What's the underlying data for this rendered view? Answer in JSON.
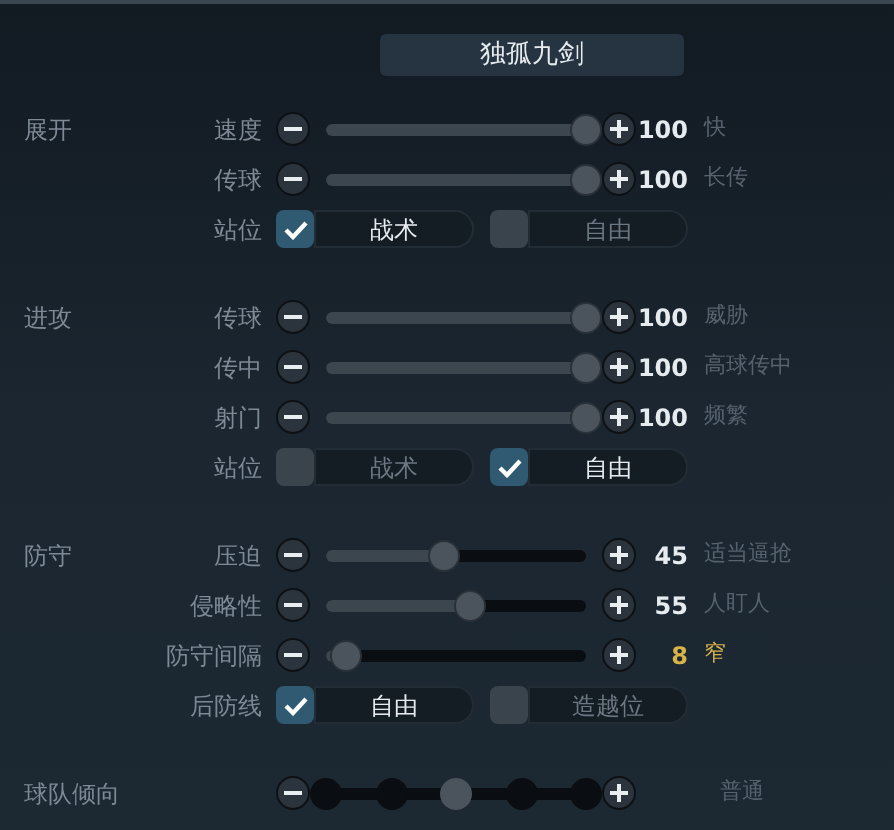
{
  "title": "独孤九剑",
  "sections": [
    {
      "label": "展开",
      "rows": [
        {
          "kind": "slider",
          "label": "速度",
          "level": 1,
          "value": "100",
          "description": "快",
          "highlighted": false
        },
        {
          "kind": "slider",
          "label": "传球",
          "level": 1,
          "value": "100",
          "description": "长传",
          "highlighted": false
        },
        {
          "kind": "choice",
          "label": "站位",
          "options": [
            {
              "label": "战术",
              "checked": true
            },
            {
              "label": "自由",
              "checked": false
            }
          ]
        }
      ]
    },
    {
      "label": "进攻",
      "rows": [
        {
          "kind": "slider",
          "label": "传球",
          "level": 1,
          "value": "100",
          "description": "威胁",
          "highlighted": false
        },
        {
          "kind": "slider",
          "label": "传中",
          "level": 1,
          "value": "100",
          "description": "高球传中",
          "highlighted": false
        },
        {
          "kind": "slider",
          "label": "射门",
          "level": 1,
          "value": "100",
          "description": "频繁",
          "highlighted": false
        },
        {
          "kind": "choice",
          "label": "站位",
          "options": [
            {
              "label": "战术",
              "checked": false
            },
            {
              "label": "自由",
              "checked": true
            }
          ]
        }
      ]
    },
    {
      "label": "防守",
      "rows": [
        {
          "kind": "slider",
          "label": "压迫",
          "level": 0.45,
          "value": "45",
          "description": "适当逼抢",
          "highlighted": false
        },
        {
          "kind": "slider",
          "label": "侵略性",
          "level": 0.55,
          "value": "55",
          "description": "人盯人",
          "highlighted": false
        },
        {
          "kind": "slider",
          "label": "防守间隔",
          "level": 0.08,
          "value": "8",
          "description": "窄",
          "highlighted": true
        },
        {
          "kind": "choice",
          "label": "后防线",
          "options": [
            {
              "label": "自由",
              "checked": true
            },
            {
              "label": "造越位",
              "checked": false
            }
          ]
        }
      ]
    },
    {
      "label": "球队倾向",
      "rows": [
        {
          "kind": "steps",
          "level": 0.5,
          "description": "普通"
        }
      ]
    }
  ]
}
